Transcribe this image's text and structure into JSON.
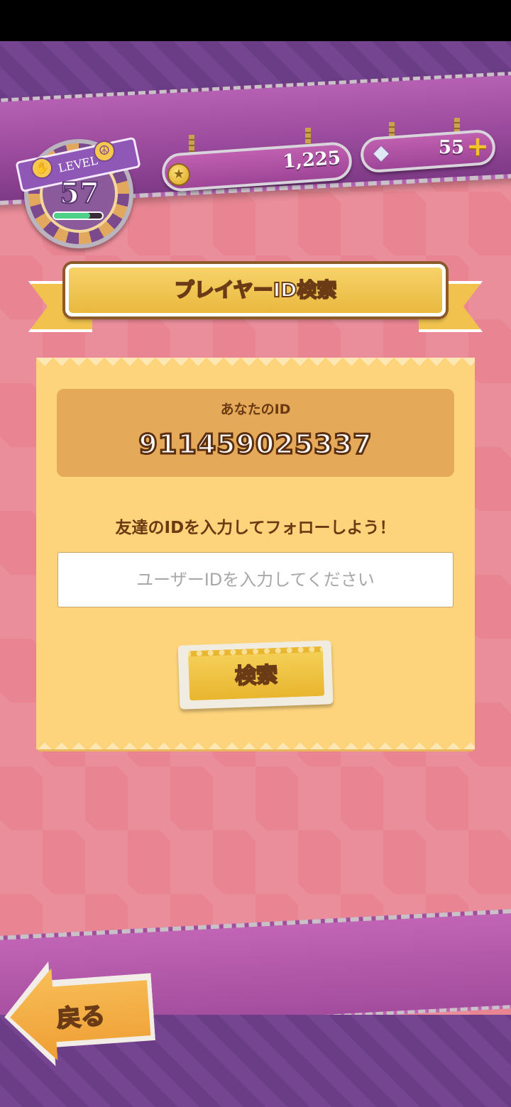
{
  "status_bar": {},
  "player": {
    "level_label": "LEVEL",
    "level": "57",
    "xp_progress": 0.75
  },
  "currency": {
    "coins": "1,225",
    "gems": "55",
    "coin_icon": "coin-icon",
    "gem_icon": "diamond-icon",
    "plus_icon": "plus-icon"
  },
  "title": "プレイヤーID検索",
  "my_id": {
    "label": "あなたのID",
    "value": "911459025337"
  },
  "follow_prompt": "友達のIDを入力してフォローしよう！",
  "search_input": {
    "placeholder": "ユーザーIDを入力してください",
    "value": ""
  },
  "search_button_label": "検索",
  "back_button_label": "戻る",
  "colors": {
    "background": "#e98593",
    "purple_ribbon": "#9e4597",
    "panel": "#fdd47c",
    "id_box": "#e5a95a",
    "gold": "#f1c34e",
    "text_brown": "#6b3a12"
  }
}
